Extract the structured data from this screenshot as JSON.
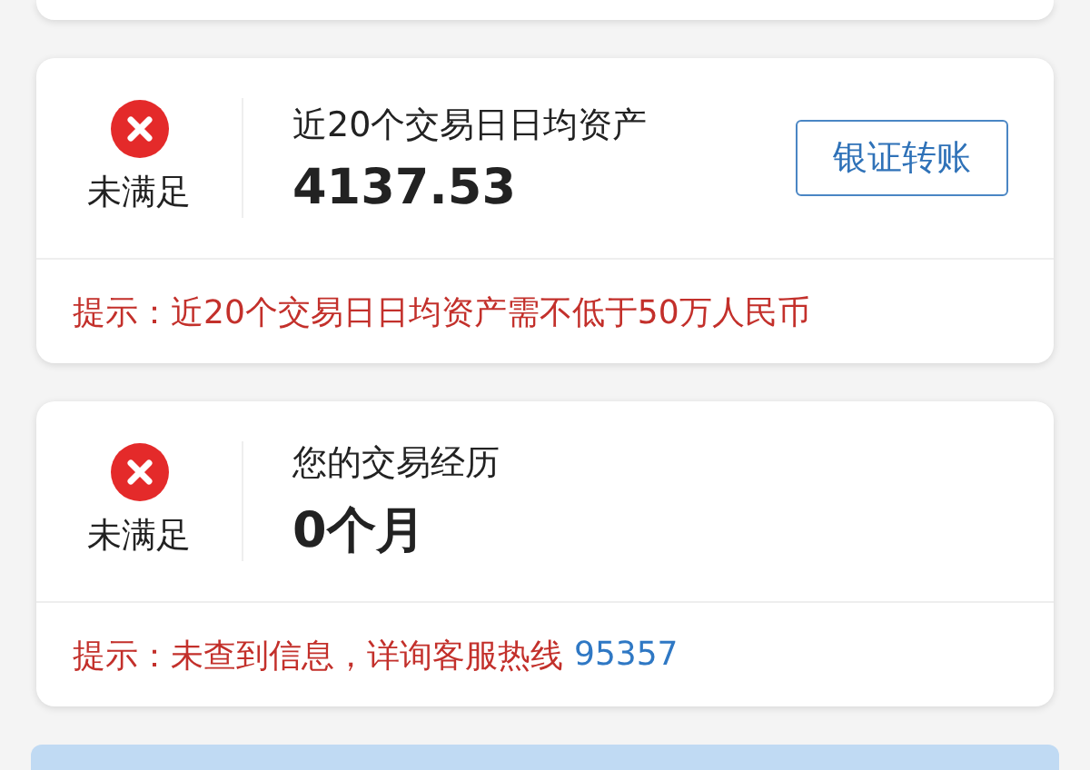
{
  "requirements": [
    {
      "met": false,
      "status": "未满足",
      "title": "近20个交易日日均资产",
      "value": "4137.53",
      "action": {
        "label": "银证转账"
      },
      "hint": {
        "text": "提示：近20个交易日日均资产需不低于50万人民币"
      }
    },
    {
      "met": false,
      "status": "未满足",
      "title": "您的交易经历",
      "value": "0个月",
      "hint": {
        "text": "提示：未查到信息，详询客服热线",
        "phone": "95357"
      }
    }
  ]
}
